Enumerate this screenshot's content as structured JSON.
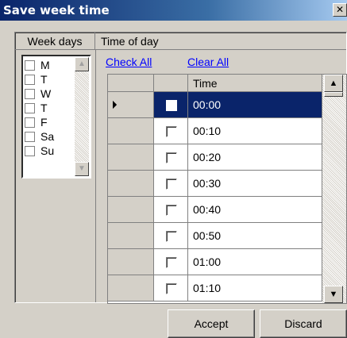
{
  "window": {
    "title": "Save week time",
    "close_glyph": "✕"
  },
  "headers": {
    "week_days": "Week days",
    "time_of_day": "Time of day"
  },
  "week_days": [
    "M",
    "T",
    "W",
    "T",
    "F",
    "Sa",
    "Su"
  ],
  "links": {
    "check_all": "Check All",
    "clear_all": "Clear All"
  },
  "grid": {
    "column_header": "Time",
    "rows": [
      "00:00",
      "00:10",
      "00:20",
      "00:30",
      "00:40",
      "00:50",
      "01:00",
      "01:10"
    ],
    "selected_index": 0
  },
  "buttons": {
    "accept": "Accept",
    "discard": "Discard"
  },
  "icons": {
    "scroll_up": "▲",
    "scroll_down": "▼",
    "row_pointer": "triangle-right-icon"
  },
  "colors": {
    "selection": "#0a246a",
    "link": "#0000ff",
    "face": "#d4d0c8"
  }
}
